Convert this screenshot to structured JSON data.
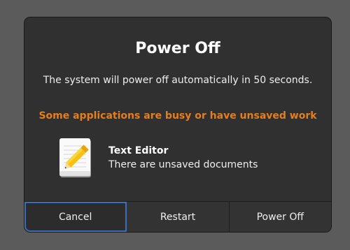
{
  "dialog": {
    "title": "Power Off",
    "message": "The system will power off automatically in 50 seconds.",
    "warning": "Some applications are busy or have unsaved work",
    "warning_color": "#e67e1a",
    "apps": [
      {
        "name": "Text Editor",
        "status": "There are unsaved documents",
        "icon": "text-editor-icon"
      }
    ],
    "buttons": {
      "cancel": "Cancel",
      "restart": "Restart",
      "power_off": "Power Off"
    }
  }
}
